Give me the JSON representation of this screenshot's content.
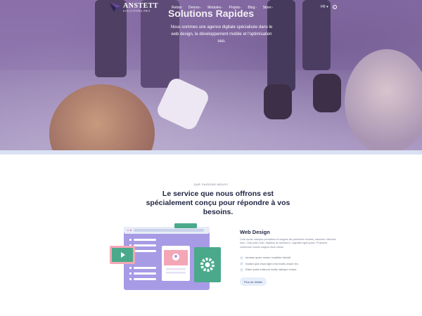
{
  "nav": {
    "logo_name": "ANSTETT",
    "logo_sub": "SOLUTIONS.PRO",
    "menu": [
      {
        "label": "Retour",
        "has_chevron": false
      },
      {
        "label": "Demos",
        "has_chevron": true
      },
      {
        "label": "Modules",
        "has_chevron": true
      },
      {
        "label": "Projets",
        "has_chevron": true
      },
      {
        "label": "Blog",
        "has_chevron": true
      },
      {
        "label": "Store",
        "has_chevron": true
      }
    ],
    "chevron": "›",
    "lang": "FR",
    "lang_chevron": "▾",
    "info_glyph": "i"
  },
  "hero": {
    "title": "Solutions Rapides",
    "description": "Nous sommes une agence digitale spécialisée dans le web design, le développement mobile et l'optimisation seo."
  },
  "services": {
    "kicker": "QUE FAISONS-NOUS?",
    "title": "Le service que nous offrons est spécialement conçu pour répondre à vos besoins.",
    "item": {
      "title": "Web Design",
      "description": "Cum sociis natoque penatibus et magnis dis parturient montes, nascetur ridiculus mus. Cras justo odio, dapibus ac facilisis in, egestas eget quam. Praesent commodo cursus magna risus varius.",
      "features": [
        "Aenean quam ornare curabitur blandit.",
        "Nullam quis risus eget urna mollis ornare leo.",
        "Etiam porta euismod mollis natoque ornare."
      ],
      "check_glyph": "✓",
      "button_label": "Plus de détails"
    }
  },
  "colors": {
    "hero_tint": "#8e77ad",
    "accent_green": "#4aa98a",
    "accent_pink": "#f3a7b6",
    "illustration_purple": "#a79be6",
    "button_bg": "#e6eefb"
  }
}
